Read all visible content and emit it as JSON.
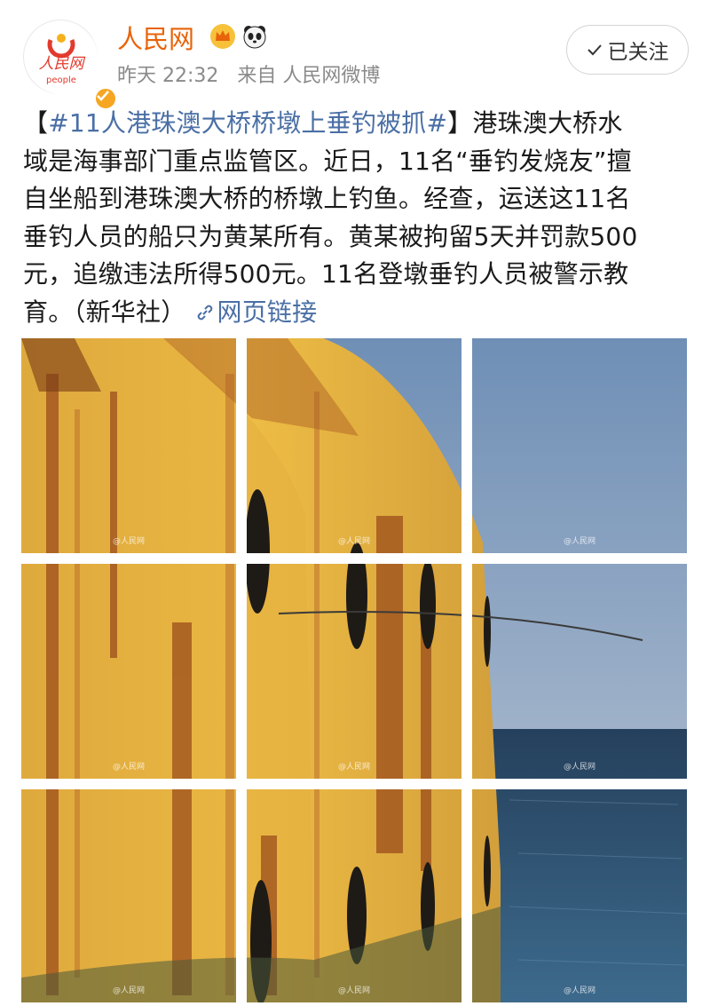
{
  "header": {
    "user_name": "人民网",
    "avatar_text": "人民网",
    "avatar_subtext": "people",
    "timestamp": "昨天 22:32",
    "source": "来自 人民网微博",
    "follow_label": "已关注",
    "badge_icons": [
      "crown-icon",
      "panda-icon"
    ]
  },
  "post": {
    "line1_open": "【",
    "line1_topic": "#11人港珠澳大桥桥墩上垂钓被抓#",
    "line1_rest": "】港珠澳大桥水",
    "line2": "域是海事部门重点监管区。近日，11名“垂钓发烧友”擅",
    "line3": "自坐船到港珠澳大桥的桥墩上钓鱼。经查，运送这11名",
    "line4": "垂钓人员的船只为黄某所有。黄某被拘留5天并罚款500",
    "line5": "元，追缴违法所得500元。11名登墩垂钓人员被警示教",
    "line6_text": "育。（新华社）",
    "link_label": "网页链接"
  },
  "photos": {
    "count": 9,
    "watermark": "@人民网"
  },
  "colors": {
    "name_orange": "#e8630a",
    "link_blue": "#4a6fa5",
    "meta_gray": "#8a8a8a",
    "pillar_yellow": "#e8b13a",
    "sky_blue": "#7f98b8",
    "sea_blue": "#2f4f6e"
  }
}
